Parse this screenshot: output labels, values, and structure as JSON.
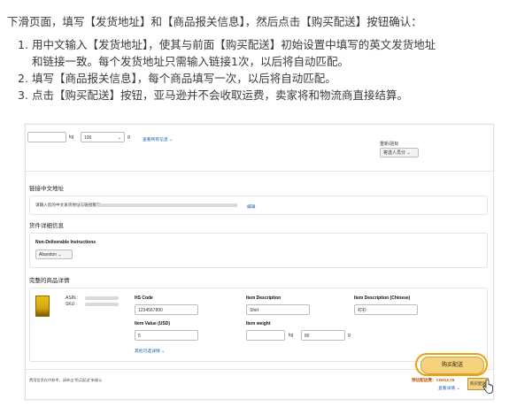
{
  "intro": "下滑页面，填写【发货地址】和【商品报关信息】，然后点击【购买配送】按钮确认：",
  "steps": [
    {
      "num": "1.",
      "line1": "用中文输入【发货地址】，使其与前面【购买配送】初始设置中填写的英文发货地址",
      "line2": "和链接一致。每个发货地址只需输入链接1次，以后将自动匹配。"
    },
    {
      "num": "2.",
      "line1": "填写【商品报关信息】，每个商品填写一次，以后将自动匹配。"
    },
    {
      "num": "3.",
      "line1": "点击【购买配送】按钮，亚马逊并不会收取运费，卖家将和物流商直接结算。"
    }
  ],
  "shot": {
    "top": {
      "kg": "kg",
      "dim": "100",
      "g": "g",
      "more_link": "查看所有信息 ⌄",
      "right_label": "重新/验标",
      "right_select": "寄送人员分 ⌄"
    },
    "address": {
      "title": "链接中文地址",
      "text": "请输入您的中文发货地址与链接服务",
      "edit": "编辑"
    },
    "shipment": {
      "title": "货件详细信息",
      "nd_label": "Non-Deliverable Instructions",
      "nd_value": "Abandon ⌄"
    },
    "customs": {
      "title": "完整的商品详情",
      "asin_label": "ASIN :",
      "sku_label": "SKU :",
      "hs_label": "HS Code",
      "hs_value": "1234567890",
      "desc_label": "Item Description",
      "desc_value": "Shirt",
      "desc_cn_label": "Item Description (Chinese)",
      "desc_cn_value": "衬衫",
      "value_label": "Item Value (USD)",
      "value_value": "5",
      "weight_label": "Item weight",
      "weight_kg": "kg",
      "weight_g_value": "80",
      "weight_g": "g",
      "more_link": "其他可选详情 ⌄"
    },
    "footer": {
      "note": "费用信息仅供参考，请单击“购买配送”来确认",
      "price": "预估配送费：CN¥13.76",
      "detail_link": "查看详情 ⌄",
      "buy_label": "购买配送",
      "buy_small": "购买配送"
    }
  }
}
